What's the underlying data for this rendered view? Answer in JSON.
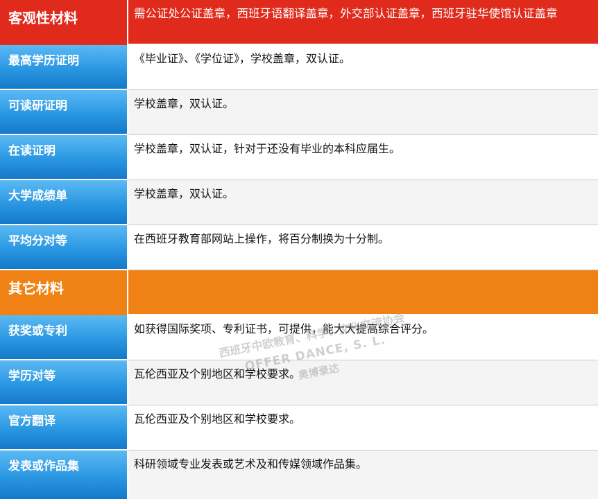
{
  "sections": [
    {
      "header": {
        "title": "客观性材料",
        "note": "需公证处公证盖章，西班牙语翻译盖章，外交部认证盖章，西班牙驻华使馆认证盖章"
      },
      "rows": [
        {
          "label": "最高学历证明",
          "value": "《毕业证》、《学位证》，学校盖章，双认证。"
        },
        {
          "label": "可读研证明",
          "value": "学校盖章，双认证。"
        },
        {
          "label": "在读证明",
          "value": "学校盖章，双认证，针对于还没有毕业的本科应届生。"
        },
        {
          "label": "大学成绩单",
          "value": "学校盖章，双认证。"
        },
        {
          "label": "平均分对等",
          "value": "在西班牙教育部网站上操作，将百分制换为十分制。"
        }
      ]
    },
    {
      "header": {
        "title": "其它材料",
        "note": ""
      },
      "rows": [
        {
          "label": "获奖或专利",
          "value": "如获得国际奖项、专利证书，可提供，能大大提高综合评分。"
        },
        {
          "label": "学历对等",
          "value": "瓦伦西亚及个别地区和学校要求。"
        },
        {
          "label": "官方翻译",
          "value": "瓦伦西亚及个别地区和学校要求。"
        },
        {
          "label": "发表或作品集",
          "value": "科研领域专业发表或艺术及和传媒领域作品集。"
        }
      ]
    }
  ],
  "watermark": {
    "line1": "西班牙中欧教育、科学、文化交流协会",
    "line2": "OFFER DANCE, S. L.",
    "line3": "奥博录达"
  },
  "colors": {
    "red": "#e02a1c",
    "orange": "#f08215",
    "blue": "#2a97e2"
  }
}
